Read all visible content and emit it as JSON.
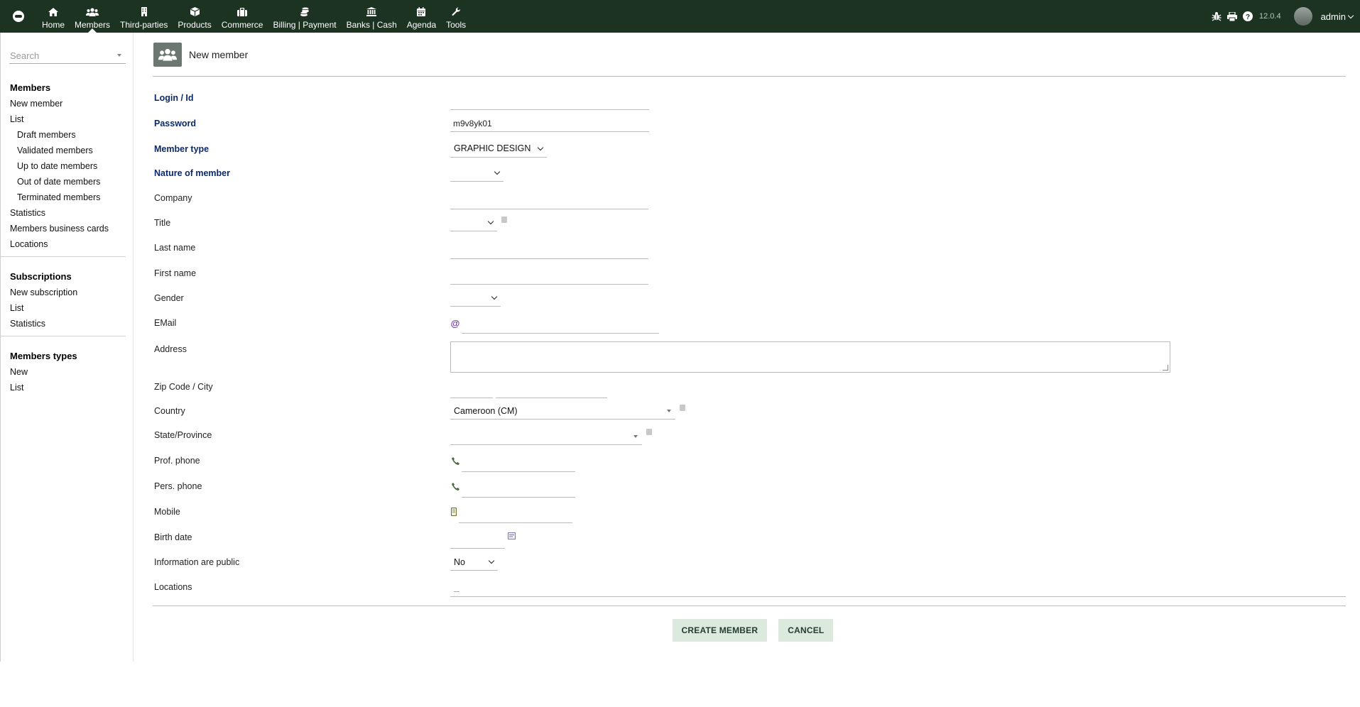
{
  "topbar": {
    "menu": [
      {
        "label": "Home",
        "icon": "home-icon"
      },
      {
        "label": "Members",
        "icon": "members-icon",
        "active": true
      },
      {
        "label": "Third-parties",
        "icon": "building-icon"
      },
      {
        "label": "Products",
        "icon": "cube-icon"
      },
      {
        "label": "Commerce",
        "icon": "briefcase-icon"
      },
      {
        "label": "Billing | Payment",
        "icon": "coins-icon"
      },
      {
        "label": "Banks | Cash",
        "icon": "bank-icon"
      },
      {
        "label": "Agenda",
        "icon": "calendar-icon"
      },
      {
        "label": "Tools",
        "icon": "wrench-icon"
      }
    ],
    "version": "12.0.4",
    "user": "admin"
  },
  "sidebar": {
    "search_placeholder": "Search",
    "members": {
      "title": "Members",
      "new": "New member",
      "list": "List",
      "draft": "Draft members",
      "validated": "Validated members",
      "uptodate": "Up to date members",
      "outofdate": "Out of date members",
      "terminated": "Terminated members",
      "statistics": "Statistics",
      "cards": "Members business cards",
      "locations": "Locations"
    },
    "subscriptions": {
      "title": "Subscriptions",
      "new": "New subscription",
      "list": "List",
      "statistics": "Statistics"
    },
    "types": {
      "title": "Members types",
      "new": "New",
      "list": "List"
    }
  },
  "page": {
    "title": "New member"
  },
  "form": {
    "login_label": "Login / Id",
    "login_value": "",
    "password_label": "Password",
    "password_value": "m9v8yk01",
    "member_type_label": "Member type",
    "member_type_value": "GRAPHIC DESIGN",
    "nature_label": "Nature of member",
    "company_label": "Company",
    "title_label": "Title",
    "lastname_label": "Last name",
    "firstname_label": "First name",
    "gender_label": "Gender",
    "email_label": "EMail",
    "address_label": "Address",
    "zip_label": "Zip Code / City",
    "country_label": "Country",
    "country_value": "Cameroon (CM)",
    "state_label": "State/Province",
    "prof_phone_label": "Prof. phone",
    "pers_phone_label": "Pers. phone",
    "mobile_label": "Mobile",
    "birth_label": "Birth date",
    "public_label": "Information are public",
    "public_value": "No",
    "locations_label": "Locations"
  },
  "buttons": {
    "create": "CREATE MEMBER",
    "cancel": "CANCEL"
  },
  "colors": {
    "topbar": "#1c3322",
    "button_bg": "#dbe9df",
    "required_label": "#0b2a6b"
  }
}
